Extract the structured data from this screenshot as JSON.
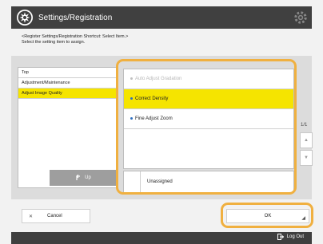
{
  "header": {
    "title": "Settings/Registration"
  },
  "instruction": {
    "line1": "<Register Settings/Registration Shortcut: Select Item.>",
    "line2": "Select the setting item to assign."
  },
  "left_list": {
    "items": [
      {
        "label": "Top",
        "selected": false
      },
      {
        "label": "Adjustment/Maintenance",
        "selected": false
      },
      {
        "label": "Adjust Image Quality",
        "selected": true
      }
    ],
    "up_label": "Up"
  },
  "right_list": {
    "options": [
      {
        "label": "Auto Adjust Gradation",
        "state": "disabled"
      },
      {
        "label": "Correct Density",
        "state": "selected"
      },
      {
        "label": "Fine Adjust Zoom",
        "state": "normal"
      }
    ],
    "unassigned_label": "Unassigned"
  },
  "pager": {
    "text": "1/1"
  },
  "buttons": {
    "cancel": "Cancel",
    "ok": "OK"
  },
  "footer": {
    "logout": "Log Out"
  },
  "colors": {
    "selected": "#f5e400",
    "highlight_border": "#f0b040",
    "header_bg": "#404040"
  }
}
